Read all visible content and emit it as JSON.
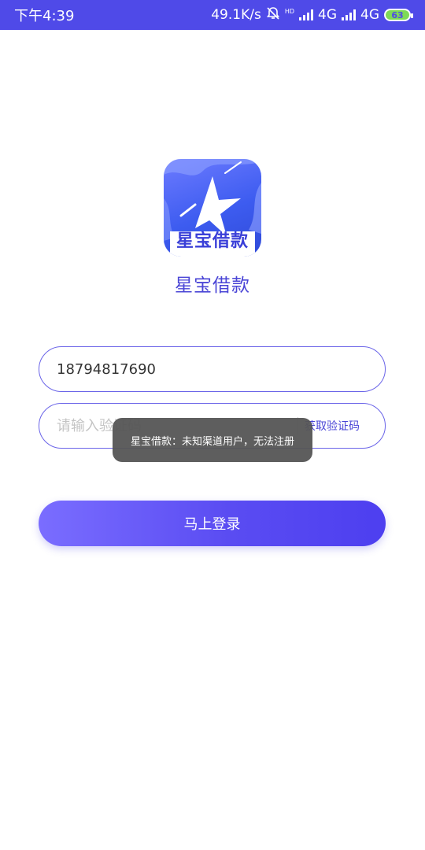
{
  "status_bar": {
    "time": "下午4:39",
    "speed": "49.1K/s",
    "hd_label": "HD",
    "network1": "4G",
    "network2": "4G",
    "battery": "63"
  },
  "app": {
    "logo_text": "星宝借款",
    "name": "星宝借款"
  },
  "form": {
    "phone_value": "18794817690",
    "code_placeholder": "请输入验证码",
    "get_code_label": "获取验证码",
    "login_label": "马上登录"
  },
  "toast": {
    "message": "星宝借款：未知渠道用户，无法注册"
  },
  "colors": {
    "brand": "#4f4ae8",
    "accent": "#4a45d6"
  }
}
